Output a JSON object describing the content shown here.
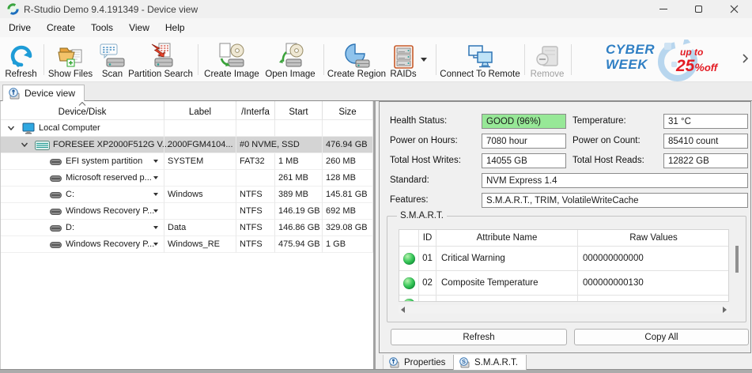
{
  "window": {
    "title": "R-Studio Demo 9.4.191349 - Device view"
  },
  "menu": {
    "items": [
      "Drive",
      "Create",
      "Tools",
      "View",
      "Help"
    ]
  },
  "toolbar": {
    "refresh": "Refresh",
    "show_files": "Show Files",
    "scan": "Scan",
    "partition_search": "Partition Search",
    "create_image": "Create Image",
    "open_image": "Open Image",
    "create_region": "Create Region",
    "raids": "RAIDs",
    "connect_to_remote": "Connect To Remote",
    "remove": "Remove",
    "banner": {
      "word1": "CYBER",
      "word2": "WEEK",
      "upto": "up to",
      "percent": "25",
      "percent_sign": "%",
      "off": "off"
    }
  },
  "tabs": {
    "device_view": "Device view"
  },
  "tree": {
    "columns": [
      "Device/Disk",
      "Label",
      "/Interfa",
      "Start",
      "Size"
    ],
    "rows": [
      {
        "name": "Local Computer",
        "label": "",
        "interface": "",
        "start": "",
        "size": ""
      },
      {
        "name": "FORESEE XP2000F512G V...",
        "label": "2000FGM4104...",
        "interface": "#0 NVME, SSD",
        "start": "",
        "size": "476.94 GB"
      },
      {
        "name": "EFI system partition",
        "label": "SYSTEM",
        "interface": "FAT32",
        "start": "1 MB",
        "size": "260 MB"
      },
      {
        "name": "Microsoft reserved p...",
        "label": "",
        "interface": "",
        "start": "261 MB",
        "size": "128 MB"
      },
      {
        "name": "C:",
        "label": "Windows",
        "interface": "NTFS",
        "start": "389 MB",
        "size": "145.81 GB"
      },
      {
        "name": "Windows Recovery P...",
        "label": "",
        "interface": "NTFS",
        "start": "146.19 GB",
        "size": "692 MB"
      },
      {
        "name": "D:",
        "label": "Data",
        "interface": "NTFS",
        "start": "146.86 GB",
        "size": "329.08 GB"
      },
      {
        "name": "Windows Recovery P...",
        "label": "Windows_RE",
        "interface": "NTFS",
        "start": "475.94 GB",
        "size": "1 GB"
      }
    ]
  },
  "smart": {
    "fields": {
      "health_label": "Health Status:",
      "health_value": "GOOD (96%)",
      "temperature_label": "Temperature:",
      "temperature_value": "31 °C",
      "power_hours_label": "Power on Hours:",
      "power_hours_value": "7080 hour",
      "power_count_label": "Power on Count:",
      "power_count_value": "85410 count",
      "writes_label": "Total Host Writes:",
      "writes_value": "14055 GB",
      "reads_label": "Total Host Reads:",
      "reads_value": "12822 GB",
      "standard_label": "Standard:",
      "standard_value": "NVM Express 1.4",
      "features_label": "Features:",
      "features_value": "S.M.A.R.T., TRIM, VolatileWriteCache"
    },
    "group_title": "S.M.A.R.T.",
    "table": {
      "columns": [
        "ID",
        "Attribute Name",
        "Raw Values"
      ],
      "rows": [
        {
          "id": "01",
          "attribute": "Critical Warning",
          "raw": "000000000000"
        },
        {
          "id": "02",
          "attribute": "Composite Temperature",
          "raw": "000000000130"
        }
      ]
    },
    "refresh_button": "Refresh",
    "copy_all_button": "Copy All"
  },
  "bottom_tabs": {
    "properties": "Properties",
    "smart": "S.M.A.R.T."
  },
  "colors": {
    "health_good_bg": "#97e897",
    "accent_blue": "#1e9cd7",
    "banner_blue": "#2f7fc4",
    "banner_red": "#e31b23",
    "selection_gray": "#d4d4d4",
    "smart_ball_green": "#0d8f34"
  }
}
